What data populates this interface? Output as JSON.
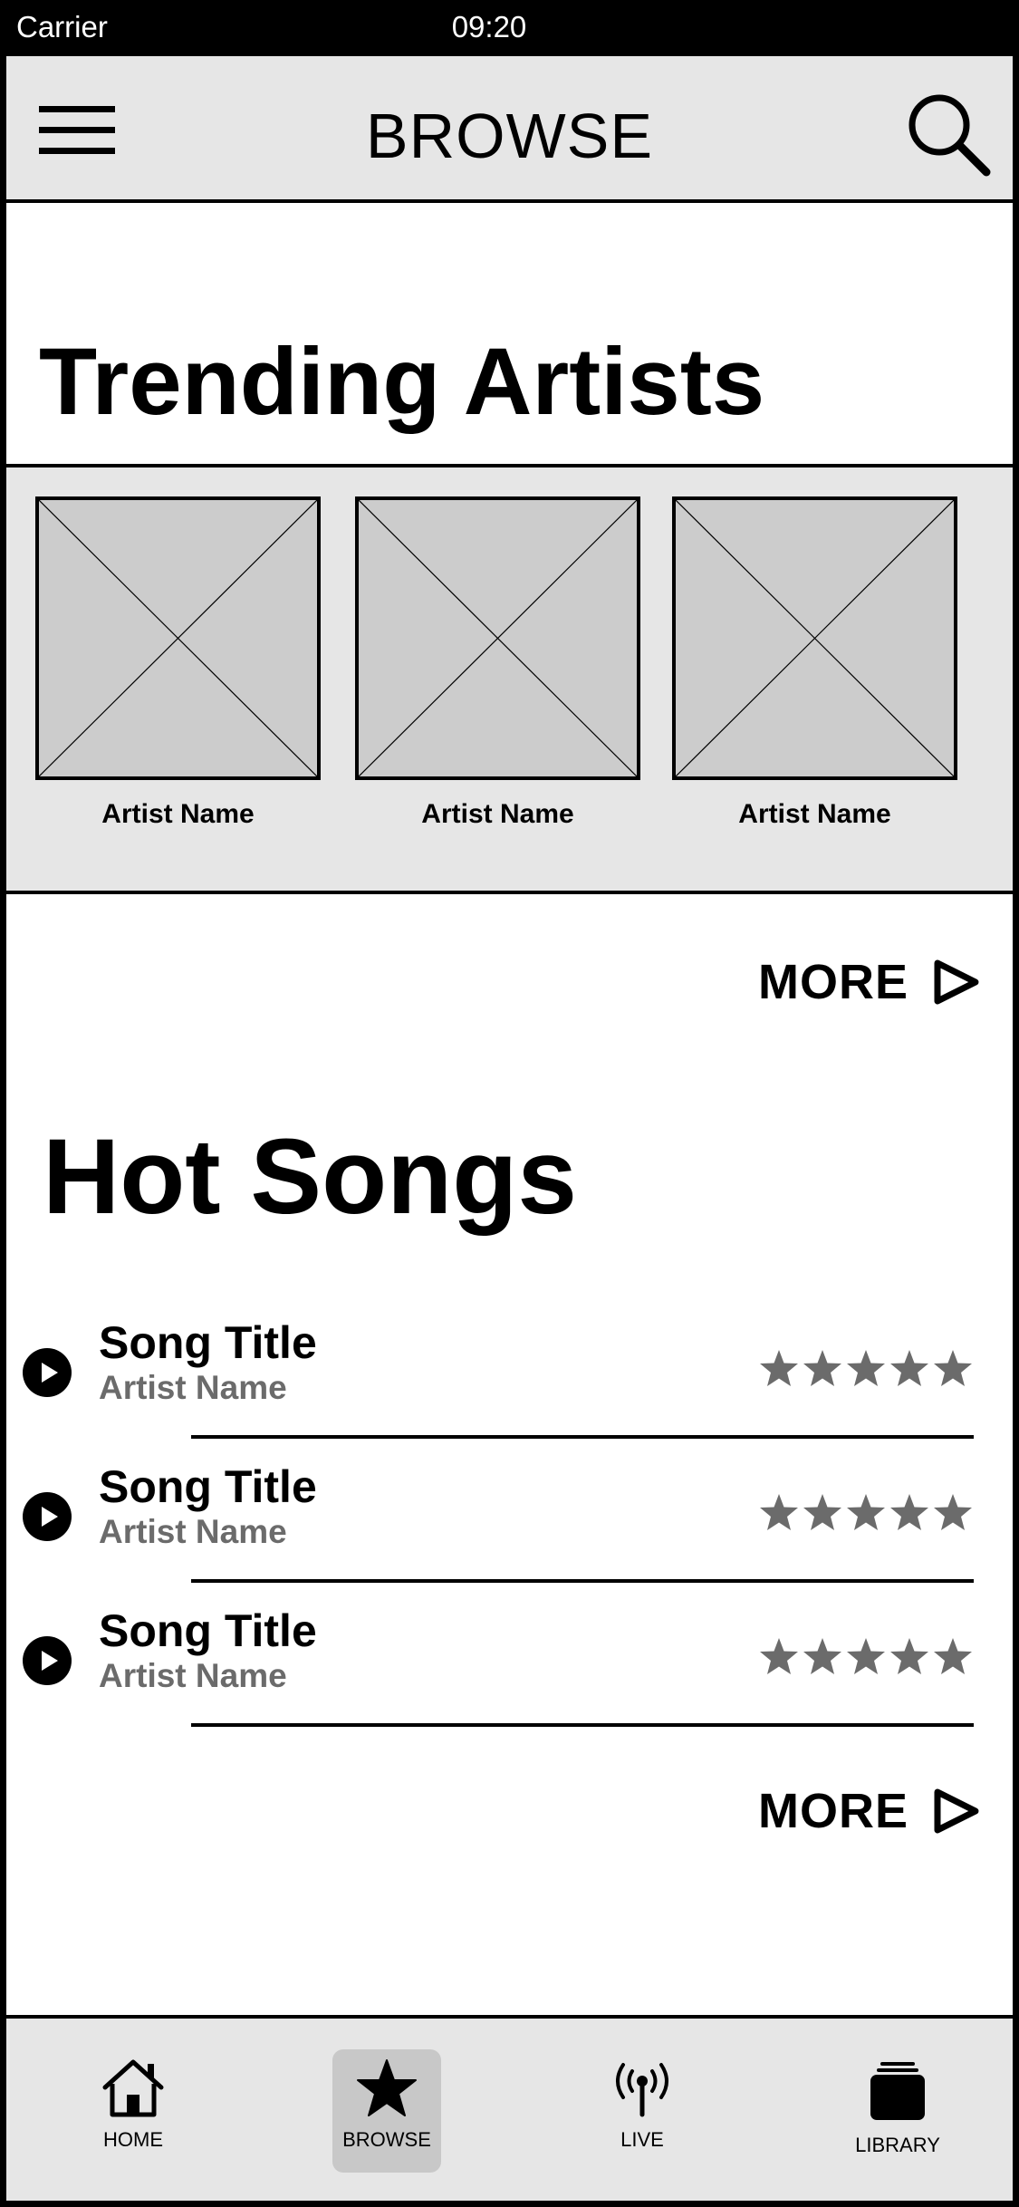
{
  "status_bar": {
    "carrier": "Carrier",
    "time": "09:20"
  },
  "header": {
    "title": "BROWSE",
    "menu_icon": "hamburger-menu-icon",
    "search_icon": "search-icon"
  },
  "trending": {
    "title": "Trending Artists",
    "artists": [
      {
        "name": "Artist Name"
      },
      {
        "name": "Artist Name"
      },
      {
        "name": "Artist Name"
      }
    ],
    "more_label": "MORE"
  },
  "hot_songs": {
    "title": "Hot Songs",
    "songs": [
      {
        "title": "Song Title",
        "artist": "Artist Name",
        "rating": 5
      },
      {
        "title": "Song Title",
        "artist": "Artist Name",
        "rating": 5
      },
      {
        "title": "Song Title",
        "artist": "Artist Name",
        "rating": 5
      }
    ],
    "more_label": "MORE"
  },
  "tabs": [
    {
      "label": "HOME",
      "icon": "home-icon",
      "active": false
    },
    {
      "label": "BROWSE",
      "icon": "star-icon",
      "active": true
    },
    {
      "label": "LIVE",
      "icon": "broadcast-icon",
      "active": false
    },
    {
      "label": "LIBRARY",
      "icon": "library-icon",
      "active": false
    }
  ],
  "colors": {
    "panel_bg": "#e6e6e6",
    "placeholder_bg": "#cccccc",
    "secondary_text": "#6b6b6b",
    "active_tab_bg": "#c8c8c8"
  }
}
